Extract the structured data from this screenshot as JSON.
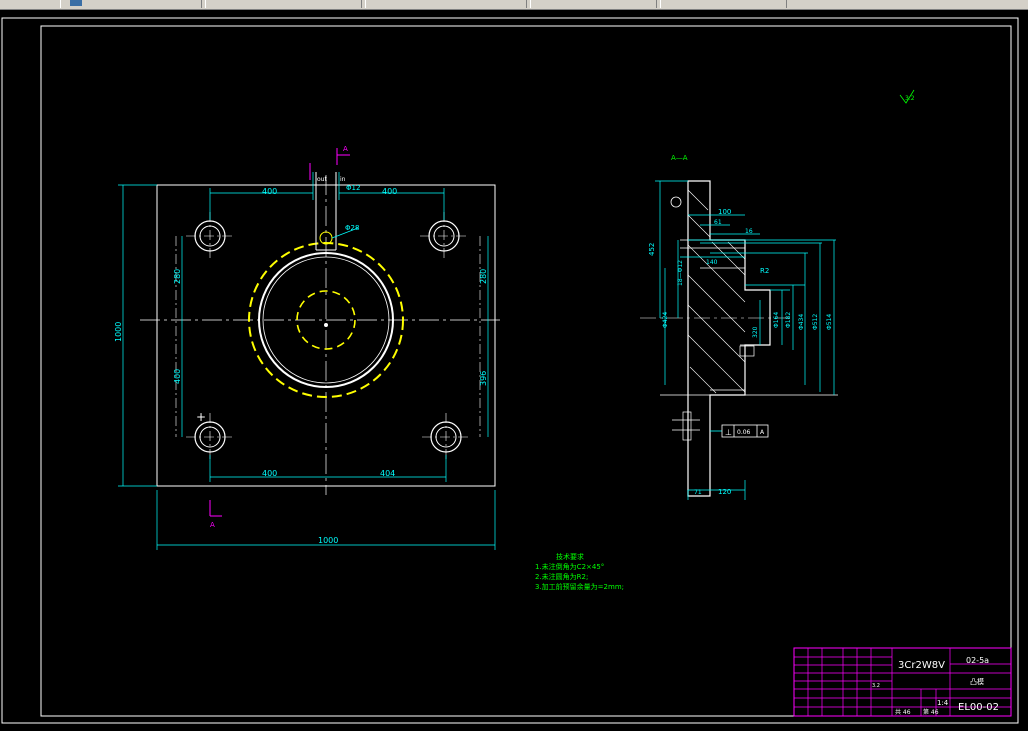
{
  "colors": {
    "background": "#000000",
    "border": "#ffffff",
    "dimension": "#00ffff",
    "centerline": "#ffffff",
    "notes": "#00ff00",
    "hidden_circle": "#ffff00",
    "section_marker": "#ff00ff",
    "title_block": "#ff00ff"
  },
  "plan_view": {
    "dims": {
      "top_left_400": "400",
      "top_right_400": "400",
      "pin_dia": "Φ12",
      "circle_dia": "Φ28",
      "left_upper_280": "280",
      "right_upper_280": "280",
      "left_lower_400": "400",
      "right_lower_396": "396",
      "height_1000": "1000",
      "bottom_left_400": "400",
      "bottom_right_404": "404",
      "width_1000": "1000"
    },
    "labels": {
      "out": "out",
      "in": "in",
      "section_top": "A",
      "section_bottom": "A"
    }
  },
  "section_view": {
    "title": "A—A",
    "corner_roughness": "3.2",
    "dims": {
      "d100": "100",
      "d61": "61",
      "d16": "16",
      "d452": "452",
      "d140": "140",
      "d18_12": "18—Φ12",
      "r2": "R2",
      "d164": "Φ164",
      "d182": "Φ182",
      "d434": "Φ434",
      "d512": "Φ512",
      "d514": "Φ514",
      "d320": "320",
      "d424": "Φ424",
      "d71": "71",
      "d120": "120",
      "tolerance_sym": "⊥",
      "tolerance_val": "0.06",
      "tolerance_ref": "A"
    }
  },
  "notes": {
    "heading": "技术要求",
    "items": [
      "1.未注倒角为C2×45°",
      "2.未注圆角为R2;",
      "3.加工前预留余量为=2mm;"
    ]
  },
  "title_block": {
    "material": "3Cr2W8V",
    "drawing_code_top": "02-5a",
    "part_name": "凸模",
    "drawing_number": "EL00-02",
    "scale": "1:4",
    "sheet_a": "共 46",
    "sheet_b": "第 46",
    "roughness_label": "3.2"
  }
}
